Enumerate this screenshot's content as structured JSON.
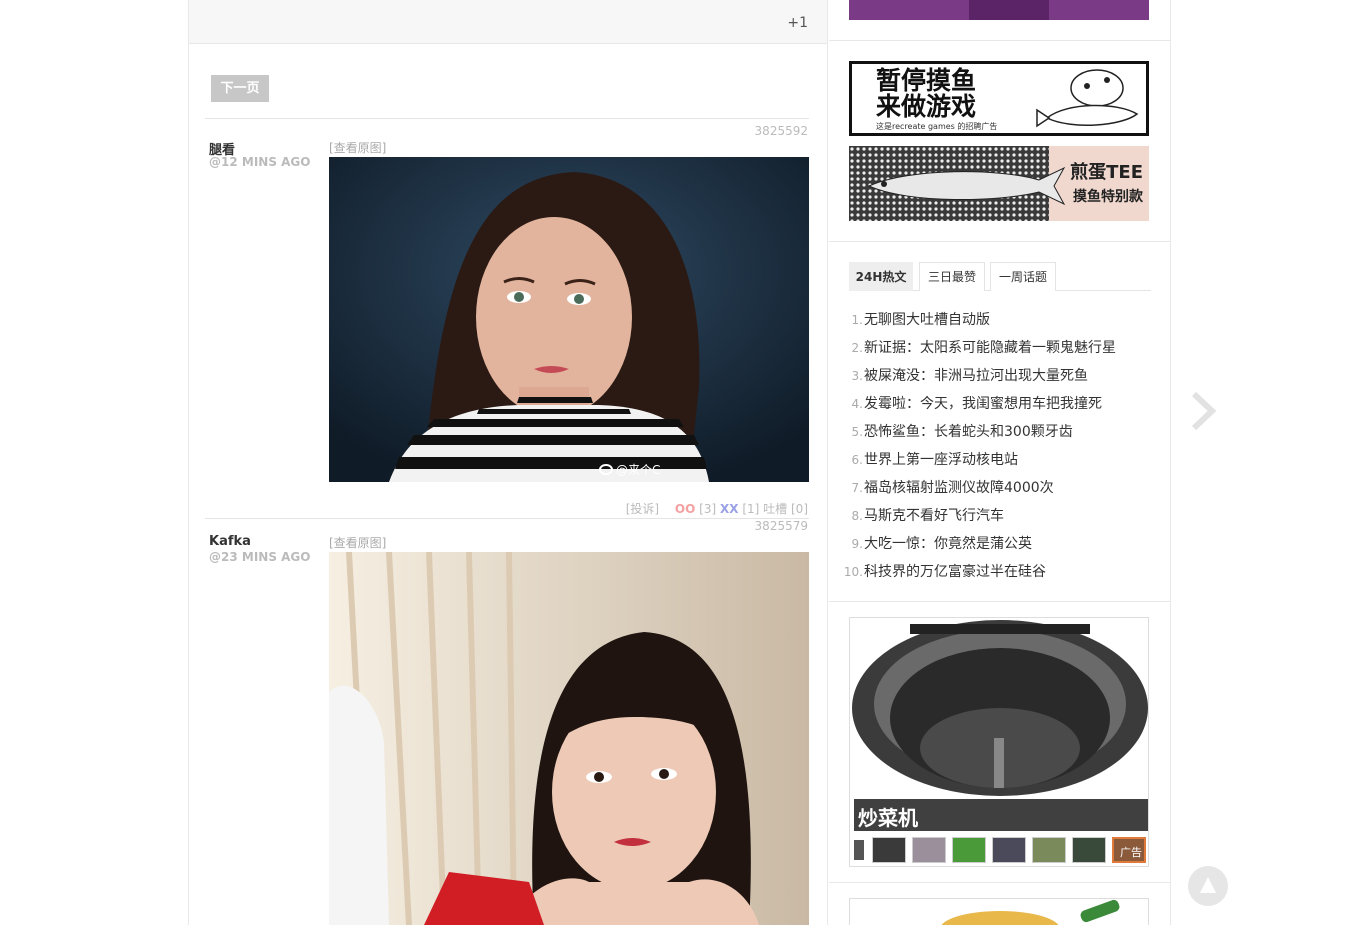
{
  "top": {
    "plus_one": "+1"
  },
  "pager": {
    "next_label": "下一页"
  },
  "posts": [
    {
      "id": "3825592",
      "author": "腿看",
      "time": "@12 MINS AGO",
      "view_original": "[查看原图]",
      "watermark": "@来个C",
      "report": "[投诉]",
      "oo_label": "OO",
      "oo_count": "[3]",
      "xx_label": "XX",
      "xx_count": "[1]",
      "comments_label": "吐槽",
      "comments_count": "[0]"
    },
    {
      "id": "3825579",
      "author": "Kafka",
      "time": "@23 MINS AGO",
      "view_original": "[查看原图]"
    }
  ],
  "sidebar": {
    "ad_recruit": {
      "line1": "暂停摸鱼",
      "line2": "来做游戏",
      "sub": "这是recreate games 的招聘广告"
    },
    "ad_tee": {
      "title": "煎蛋TEE",
      "sub": "摸鱼特别款"
    },
    "tabs": [
      "24H热文",
      "三日最赞",
      "一周话题"
    ],
    "hot_list": [
      {
        "num": "1.",
        "title": "无聊图大吐槽自动版"
      },
      {
        "num": "2.",
        "title": "新证据：太阳系可能隐藏着一颗鬼魅行星"
      },
      {
        "num": "3.",
        "title": "被屎淹没：非洲马拉河出现大量死鱼"
      },
      {
        "num": "4.",
        "title": "发霉啦：今天，我闺蜜想用车把我撞死"
      },
      {
        "num": "5.",
        "title": "恐怖鲨鱼：长着蛇头和300颗牙齿"
      },
      {
        "num": "6.",
        "title": "世界上第一座浮动核电站"
      },
      {
        "num": "7.",
        "title": "福岛核辐射监测仪故障4000次"
      },
      {
        "num": "8.",
        "title": "马斯克不看好飞行汽车"
      },
      {
        "num": "9.",
        "title": "大吃一惊：你竟然是蒲公英"
      },
      {
        "num": "10.",
        "title": "科技界的万亿富豪过半在硅谷"
      }
    ],
    "product_ad": {
      "caption": "炒菜机",
      "badge": "广告"
    }
  },
  "colors": {
    "oo": "#f4a0a0",
    "xx": "#99a0e6",
    "next_button": "#c7c7c7"
  },
  "icons": {
    "next": "chevron-right-icon",
    "top": "triangle-up-icon",
    "weibo": "weibo-icon"
  }
}
